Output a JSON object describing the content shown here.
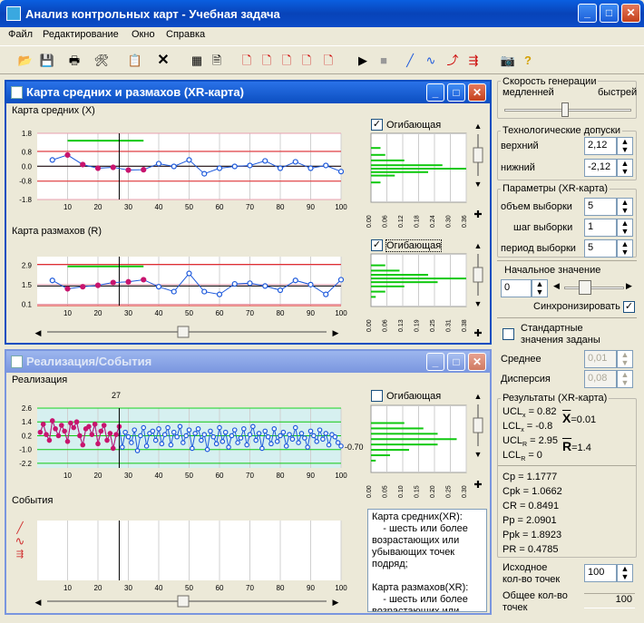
{
  "app": {
    "title": "Анализ контрольных карт - Учебная задача"
  },
  "menu": [
    "Файл",
    "Редактирование",
    "Окно",
    "Справка"
  ],
  "xr_window": {
    "title": "Карта средних и размахов (XR-карта)",
    "mean_chart": {
      "label": "Карта средних (X)",
      "envelope_label": "Огибающая"
    },
    "range_chart": {
      "label": "Карта размахов (R)",
      "envelope_label": "Огибающая"
    }
  },
  "impl_window": {
    "title": "Реализация/События",
    "impl_chart": {
      "label": "Реализация",
      "envelope_label": "Огибающая",
      "cursor_label": "27",
      "last_label": "-0.70"
    },
    "events": {
      "label": "События",
      "text_lines": [
        "Карта средних(XR):",
        "    - шесть или более",
        "возрастающих или",
        "убывающих точек",
        "подряд;",
        "",
        "Карта размахов(XR):",
        "    - шесть или более",
        "возрастающих или"
      ]
    }
  },
  "chart_data": [
    {
      "type": "line",
      "title": "Карта средних (X)",
      "x": [
        5,
        10,
        15,
        20,
        25,
        30,
        35,
        40,
        45,
        50,
        55,
        60,
        65,
        70,
        75,
        80,
        85,
        90,
        95,
        100
      ],
      "values": [
        0.35,
        0.62,
        0.1,
        -0.1,
        -0.05,
        -0.2,
        -0.18,
        0.15,
        0.0,
        0.35,
        -0.4,
        -0.1,
        0.0,
        0.05,
        0.3,
        -0.1,
        0.25,
        -0.1,
        0.05,
        -0.28
      ],
      "ylim": [
        -1.8,
        1.8
      ],
      "yticks": [
        "1.8",
        "0.8",
        "0.0",
        "-0.8",
        "-1.8"
      ],
      "xticks": [
        "10",
        "20",
        "30",
        "40",
        "50",
        "60",
        "70",
        "80",
        "90",
        "100"
      ],
      "ucl": 0.82,
      "lcl": -0.8,
      "center": 0.01,
      "cursor_x": 27,
      "limit_segment": [
        10,
        35,
        1.4
      ],
      "histogram": {
        "xticks": [
          "0.00",
          "0.06",
          "0.12",
          "0.18",
          "0.24",
          "0.30",
          "0.36"
        ]
      }
    },
    {
      "type": "line",
      "title": "Карта размахов (R)",
      "x": [
        5,
        10,
        15,
        20,
        25,
        30,
        35,
        40,
        45,
        50,
        55,
        60,
        65,
        70,
        75,
        80,
        85,
        90,
        95,
        100
      ],
      "values": [
        1.8,
        1.2,
        1.35,
        1.45,
        1.65,
        1.7,
        1.85,
        1.35,
        1.0,
        2.3,
        1.0,
        0.8,
        1.55,
        1.6,
        1.4,
        1.1,
        1.8,
        1.5,
        0.8,
        1.85
      ],
      "ylim": [
        0,
        3.5
      ],
      "yticks": [
        "2.9",
        "1.5",
        "0.1"
      ],
      "xticks": [
        "10",
        "20",
        "30",
        "40",
        "50",
        "60",
        "70",
        "80",
        "90",
        "100"
      ],
      "ucl": 2.95,
      "lcl": 0,
      "center": 1.4,
      "cursor_x": 27,
      "limit_segment": [
        10,
        35,
        2.8
      ],
      "histogram": {
        "xticks": [
          "0.00",
          "0.06",
          "0.13",
          "0.19",
          "0.25",
          "0.31",
          "0.38"
        ]
      }
    },
    {
      "type": "line",
      "title": "Реализация",
      "x_count": 100,
      "values": [
        0.5,
        1.2,
        0.3,
        -0.2,
        1.5,
        0.8,
        0.2,
        1.1,
        0.6,
        -0.3,
        1.3,
        0.9,
        1.4,
        0.2,
        -0.6,
        0.8,
        1.0,
        0.3,
        1.2,
        -0.5,
        0.6,
        1.1,
        -0.2,
        0.4,
        -0.9,
        0.3,
        1.0,
        -0.8,
        0.5,
        0.1,
        -0.4,
        0.7,
        -1.1,
        0.2,
        0.9,
        -0.7,
        0.4,
        0.6,
        -0.2,
        0.8,
        -0.5,
        0.3,
        0.9,
        -0.6,
        0.5,
        0.1,
        1.0,
        -0.4,
        0.2,
        0.7,
        -0.9,
        0.4,
        0.8,
        -0.2,
        0.3,
        -1.0,
        0.6,
        0.1,
        -0.5,
        0.9,
        -0.3,
        0.5,
        -0.8,
        0.2,
        0.7,
        -0.4,
        0.0,
        0.8,
        -0.6,
        0.3,
        1.0,
        -0.2,
        0.4,
        -0.9,
        0.6,
        0.1,
        -0.5,
        0.8,
        -0.3,
        0.2,
        0.5,
        -0.7,
        0.3,
        -0.1,
        0.9,
        -0.4,
        0.4,
        0.0,
        -0.8,
        0.6,
        0.2,
        -0.3,
        0.7,
        -0.1,
        0.4,
        -0.6,
        0.3,
        0.1,
        -0.4,
        -0.7
      ],
      "highlight_count": 27,
      "ylim": [
        -2.6,
        2.6
      ],
      "yticks": [
        "2.6",
        "1.4",
        "0.2",
        "-1.0",
        "-2.2"
      ],
      "xticks": [
        "10",
        "20",
        "30",
        "40",
        "50",
        "60",
        "70",
        "80",
        "90",
        "100"
      ],
      "histogram": {
        "xticks": [
          "0.00",
          "0.05",
          "0.10",
          "0.15",
          "0.20",
          "0.25",
          "0.30"
        ]
      }
    },
    {
      "type": "line",
      "title": "События",
      "xticks": [
        "10",
        "20",
        "30",
        "40",
        "50",
        "60",
        "70",
        "80",
        "90",
        "100"
      ],
      "cursor_x": 27
    }
  ],
  "right": {
    "speed": {
      "label": "Скорость генерации",
      "slow": "медленней",
      "fast": "быстрей",
      "level": 0.45
    },
    "tol": {
      "label": "Технологические допуски",
      "upper_label": "верхний",
      "upper": "2,12",
      "lower_label": "нижний",
      "lower": "-2,12"
    },
    "params": {
      "label": "Параметры (XR-карта)",
      "vol_label": "объем выборки",
      "vol": "5",
      "step_label": "шаг выборки",
      "step": "1",
      "period_label": "период выборки",
      "period": "5"
    },
    "init": {
      "label": "Начальное значение",
      "value": "0",
      "sync_label": "Синхронизировать"
    },
    "std": {
      "label1": "Стандартные",
      "label2": "значения заданы",
      "mean_label": "Среднее",
      "mean": "0,01",
      "disp_label": "Дисперсия",
      "disp": "0,08"
    },
    "results": {
      "label": "Результаты (XR-карта)",
      "uclx": "UCL",
      "uclx_sub": "x",
      "uclx_val": "= 0.82",
      "lclx": "LCL",
      "lclx_sub": "x",
      "lclx_val": "= -0.8",
      "uclr": "UCL",
      "uclr_sub": "R",
      "uclr_val": "= 2.95",
      "lclr": "LCL",
      "lclr_sub": "R",
      "lclr_val": "= 0",
      "xbar": "X",
      "xbar_val": "=0.01",
      "rbar": "R",
      "rbar_val": "=1.4",
      "stats": [
        "Cp = 1.1777",
        "Cpk = 1.0662",
        "CR = 0.8491",
        "Pp = 2.0901",
        "Ppk = 1.8923",
        "PR = 0.4785"
      ]
    },
    "source": {
      "label1": "Исходное",
      "label2": "кол-во точек",
      "value": "100"
    },
    "total": {
      "label1": "Общее кол-во",
      "label2": "точек",
      "value": "100"
    }
  },
  "colors": {
    "blue": "#1e5adc",
    "mag": "#c8146e",
    "green": "#0fc80f",
    "red": "#e03030",
    "navy": "#0b4ec0"
  }
}
